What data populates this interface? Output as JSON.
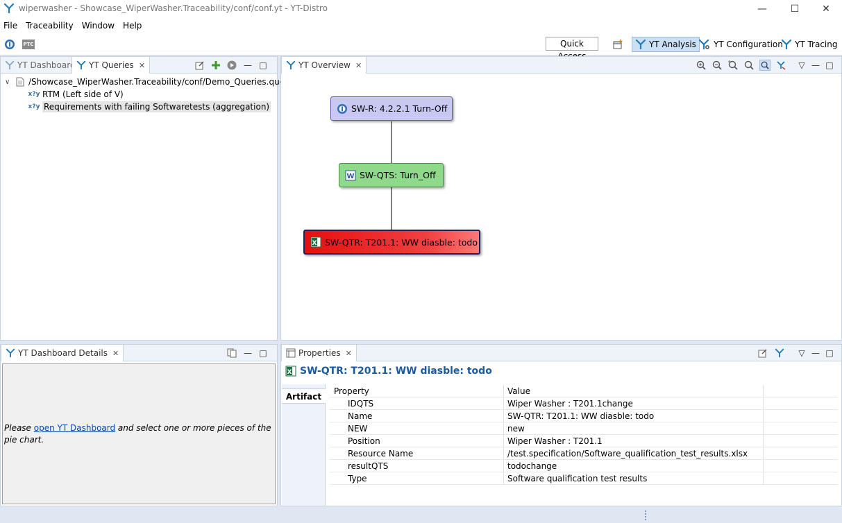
{
  "window": {
    "title": "wiperwasher - Showcase_WiperWasher.Traceability/conf/conf.yt - YT-Distro"
  },
  "menu": [
    "File",
    "Traceability",
    "Window",
    "Help"
  ],
  "toolbar": {
    "ptc_label": "PTC",
    "quick_access": "Quick Access",
    "perspectives": [
      {
        "label": "YT Analysis",
        "active": true
      },
      {
        "label": "YT Configuration",
        "active": false
      },
      {
        "label": "YT Tracing",
        "active": false
      }
    ]
  },
  "left_panel": {
    "tabs": [
      {
        "label": "YT Dashboard",
        "active": false
      },
      {
        "label": "YT Queries",
        "active": true
      }
    ],
    "tree": {
      "root": "/Showcase_WiperWasher.Traceability/conf/Demo_Queries.query",
      "children": [
        {
          "label": "RTM (Left side of V)",
          "selected": false
        },
        {
          "label": "Requirements with failing Softwaretests (aggregation)",
          "selected": true
        }
      ]
    }
  },
  "overview": {
    "tab": "YT Overview",
    "nodes": [
      {
        "label": "SW-R: 4.2.2.1 Turn-Off",
        "color": "#c9c8f2",
        "border": "#5a5aa0"
      },
      {
        "label": "SW-QTS: Turn_Off",
        "color": "#8ed98a",
        "border": "#4f8f4a"
      },
      {
        "label": "SW-QTR: T201.1: WW diasble: todo",
        "color": "#ee1c1c",
        "border": "#1e1e60"
      }
    ]
  },
  "details": {
    "tab": "YT Dashboard Details",
    "text_before": "Please ",
    "link": "open YT Dashboard",
    "text_after": " and select one or more pieces of the pie chart."
  },
  "properties": {
    "tab": "Properties",
    "title": "SW-QTR: T201.1: WW diasble: todo",
    "side_tab": "Artifact",
    "columns": [
      "Property",
      "Value"
    ],
    "rows": [
      {
        "key": "IDQTS",
        "value": "Wiper Washer : T201.1change"
      },
      {
        "key": "Name",
        "value": "SW-QTR: T201.1: WW diasble: todo"
      },
      {
        "key": "NEW",
        "value": "new"
      },
      {
        "key": "Position",
        "value": "Wiper Washer : T201.1"
      },
      {
        "key": "Resource Name",
        "value": "/test.specification/Software_qualification_test_results.xlsx"
      },
      {
        "key": "resultQTS",
        "value": "todochange"
      },
      {
        "key": "Type",
        "value": "Software qualification test results"
      }
    ]
  }
}
